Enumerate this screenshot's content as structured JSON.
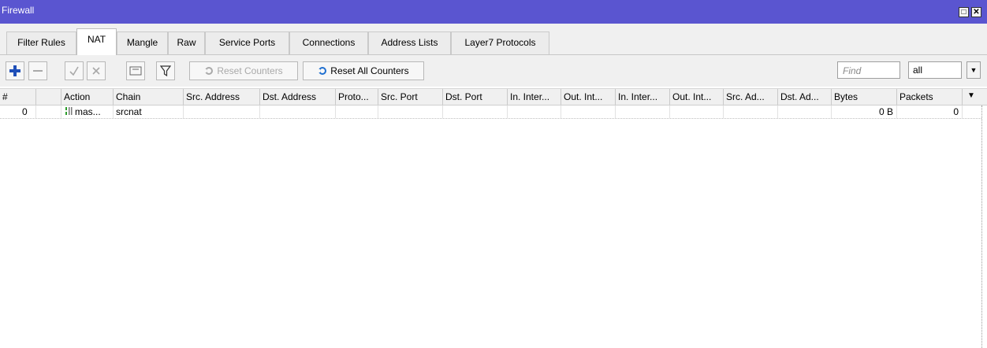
{
  "window": {
    "title": "Firewall"
  },
  "tabs": [
    {
      "label": "Filter Rules"
    },
    {
      "label": "NAT",
      "active": true
    },
    {
      "label": "Mangle"
    },
    {
      "label": "Raw"
    },
    {
      "label": "Service Ports"
    },
    {
      "label": "Connections"
    },
    {
      "label": "Address Lists"
    },
    {
      "label": "Layer7 Protocols"
    }
  ],
  "toolbar": {
    "add_icon": "plus-icon",
    "remove_icon": "minus-icon",
    "enable_icon": "check-icon",
    "disable_icon": "x-icon",
    "comment_icon": "note-icon",
    "filter_icon": "funnel-icon",
    "reset_counters_label": "Reset Counters",
    "reset_all_counters_label": "Reset All Counters",
    "find_placeholder": "Find",
    "filter_value": "all",
    "accent_color": "#1f4fb8",
    "disabled_color": "#a9a9a9"
  },
  "table": {
    "columns": [
      "#",
      "",
      "Action",
      "Chain",
      "Src. Address",
      "Dst. Address",
      "Proto...",
      "Src. Port",
      "Dst. Port",
      "In. Inter...",
      "Out. Int...",
      "In. Inter...",
      "Out. Int...",
      "Src. Ad...",
      "Dst. Ad...",
      "Bytes",
      "Packets"
    ],
    "rows": [
      {
        "index": "0",
        "action": "mas...",
        "chain": "srcnat",
        "src_address": "",
        "dst_address": "",
        "protocol": "",
        "src_port": "",
        "dst_port": "",
        "in_interface": "",
        "out_interface": "",
        "in_interface_list": "",
        "out_interface_list": "",
        "src_address_list": "",
        "dst_address_list": "",
        "bytes": "0 B",
        "packets": "0"
      }
    ]
  }
}
